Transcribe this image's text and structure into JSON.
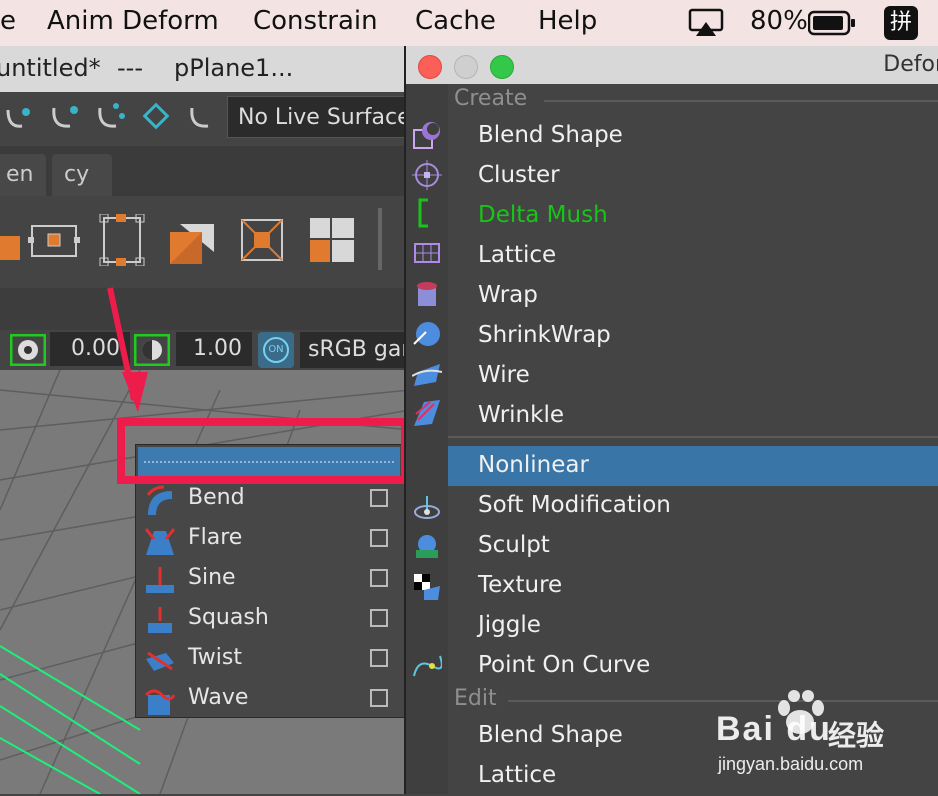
{
  "menubar": {
    "items": [
      "e",
      "Anim Deform",
      "Constrain",
      "Cache",
      "Help"
    ],
    "battery": "80%",
    "input_method": "拼"
  },
  "titlebar": {
    "doc": "untitled*",
    "sep": "---",
    "object": "pPlane1..."
  },
  "shelf": {
    "live_surface": "No Live Surface"
  },
  "tabs": [
    "en",
    "cy"
  ],
  "viewport_toolbar": {
    "exposure": "0.00",
    "gamma": "1.00",
    "toggle": "ON",
    "color_space": "sRGB gam"
  },
  "nonlinear_submenu": {
    "items": [
      {
        "label": "Bend",
        "icon": "bend-icon"
      },
      {
        "label": "Flare",
        "icon": "flare-icon"
      },
      {
        "label": "Sine",
        "icon": "sine-icon"
      },
      {
        "label": "Squash",
        "icon": "squash-icon"
      },
      {
        "label": "Twist",
        "icon": "twist-icon"
      },
      {
        "label": "Wave",
        "icon": "wave-icon"
      }
    ]
  },
  "deform_window": {
    "title": "Defor",
    "create_section": "Create",
    "create_items": [
      "Blend Shape",
      "Cluster",
      "Delta Mush",
      "Lattice",
      "Wrap",
      "ShrinkWrap",
      "Wire",
      "Wrinkle",
      "Nonlinear",
      "Soft Modification",
      "Sculpt",
      "Texture",
      "Jiggle",
      "Point On Curve"
    ],
    "edit_section": "Edit",
    "edit_items": [
      "Blend Shape",
      "Lattice"
    ]
  },
  "colors": {
    "highlight_row": "#3a75a8",
    "delta_mush": "#18c418",
    "annotation_red": "#ee1c4a"
  },
  "watermark": {
    "brand": "Bai du",
    "cn": "经验",
    "url": "jingyan.baidu.com"
  }
}
